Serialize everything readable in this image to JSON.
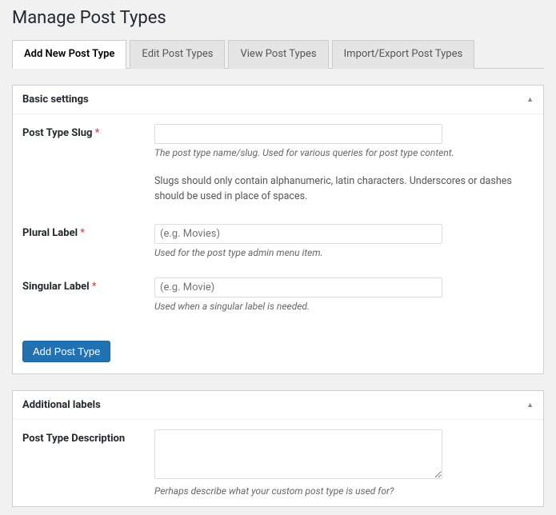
{
  "page": {
    "title": "Manage Post Types"
  },
  "tabs": {
    "add": "Add New Post Type",
    "edit": "Edit Post Types",
    "view": "View Post Types",
    "import": "Import/Export Post Types"
  },
  "panels": {
    "basic": {
      "title": "Basic settings",
      "fields": {
        "slug": {
          "label": "Post Type Slug",
          "help": "The post type name/slug. Used for various queries for post type content.",
          "help2": "Slugs should only contain alphanumeric, latin characters. Underscores or dashes should be used in place of spaces."
        },
        "plural": {
          "label": "Plural Label",
          "placeholder": "(e.g. Movies)",
          "help": "Used for the post type admin menu item."
        },
        "singular": {
          "label": "Singular Label",
          "placeholder": "(e.g. Movie)",
          "help": "Used when a singular label is needed."
        }
      },
      "submit": "Add Post Type"
    },
    "additional": {
      "title": "Additional labels",
      "fields": {
        "description": {
          "label": "Post Type Description",
          "help": "Perhaps describe what your custom post type is used for?"
        }
      }
    }
  },
  "required_marker": "*"
}
